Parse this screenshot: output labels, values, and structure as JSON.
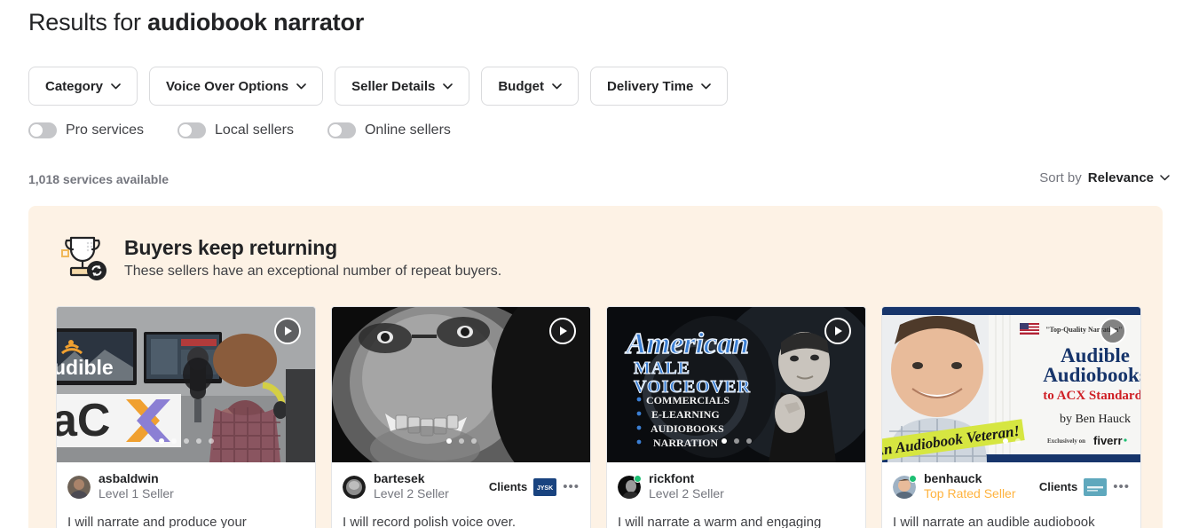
{
  "header": {
    "prefix": "Results for ",
    "query": "audiobook narrator"
  },
  "filters": [
    {
      "label": "Category",
      "icon": "chevron-down-icon"
    },
    {
      "label": "Voice Over Options",
      "icon": "chevron-down-icon"
    },
    {
      "label": "Seller Details",
      "icon": "chevron-down-icon"
    },
    {
      "label": "Budget",
      "icon": "chevron-down-icon"
    },
    {
      "label": "Delivery Time",
      "icon": "chevron-down-icon"
    }
  ],
  "toggles": [
    {
      "label": "Pro services",
      "on": false
    },
    {
      "label": "Local sellers",
      "on": false
    },
    {
      "label": "Online sellers",
      "on": false
    }
  ],
  "results": {
    "count_text": "1,018 services available",
    "sort_by_label": "Sort by",
    "sort_value": "Relevance",
    "sort_icon": "chevron-down-icon"
  },
  "banner": {
    "icon": "trophy-repeat-icon",
    "title": "Buyers keep returning",
    "subtitle": "These sellers have an exceptional number of repeat buyers.",
    "background_color": "#fdf2e5"
  },
  "cards": [
    {
      "seller": "asbaldwin",
      "level": "Level 1 Seller",
      "level_style": "normal",
      "online": false,
      "clients_label": null,
      "client_logo_text": null,
      "more_icon": null,
      "title": "I will narrate and produce your",
      "play_icon": "play-icon",
      "dots_total": 5,
      "dots_active": 0,
      "thumb_overlay": {
        "line1": "udible",
        "line2": "aCX"
      }
    },
    {
      "seller": "bartesek",
      "level": "Level 2 Seller",
      "level_style": "normal",
      "online": false,
      "clients_label": "Clients",
      "client_logo_text": "JYSK",
      "more_icon": "more-options-icon",
      "title": "I will record polish voice over.",
      "play_icon": "play-icon",
      "dots_total": 3,
      "dots_active": 0,
      "thumb_overlay": null
    },
    {
      "seller": "rickfont",
      "level": "Level 2 Seller",
      "level_style": "normal",
      "online": true,
      "clients_label": null,
      "client_logo_text": null,
      "more_icon": null,
      "title": "I will narrate a warm and engaging",
      "play_icon": "play-icon",
      "dots_total": 3,
      "dots_active": 0,
      "thumb_overlay": {
        "line1": "American",
        "line2": "MALE",
        "line3": "VOICEOVER",
        "bullets": [
          "COMMERCIALS",
          "E-LEARNING",
          "AUDIOBOOKS",
          "NARRATION"
        ]
      }
    },
    {
      "seller": "benhauck",
      "level": "Top Rated Seller",
      "level_style": "top",
      "online": true,
      "clients_label": "Clients",
      "client_logo_text": "",
      "more_icon": "more-options-icon",
      "title": "I will narrate an audible audiobook",
      "play_icon": "play-icon",
      "dots_total": 2,
      "dots_active": 0,
      "thumb_overlay": {
        "quality": "\"Top-Quality Narration\"",
        "line1": "Audible",
        "line2": "Audiobooks",
        "line3": "to ACX Standards",
        "byline": "by Ben Hauck",
        "exclusive": "Exclusively on",
        "brand": "fiverr",
        "ribbon": "An Audiobook Veteran!",
        "flag": "us-flag-icon"
      }
    }
  ],
  "colors": {
    "top_rated": "#ffb33e",
    "online": "#1dbf73",
    "banner_bg": "#fdf2e5",
    "muted_text": "#74767e"
  }
}
